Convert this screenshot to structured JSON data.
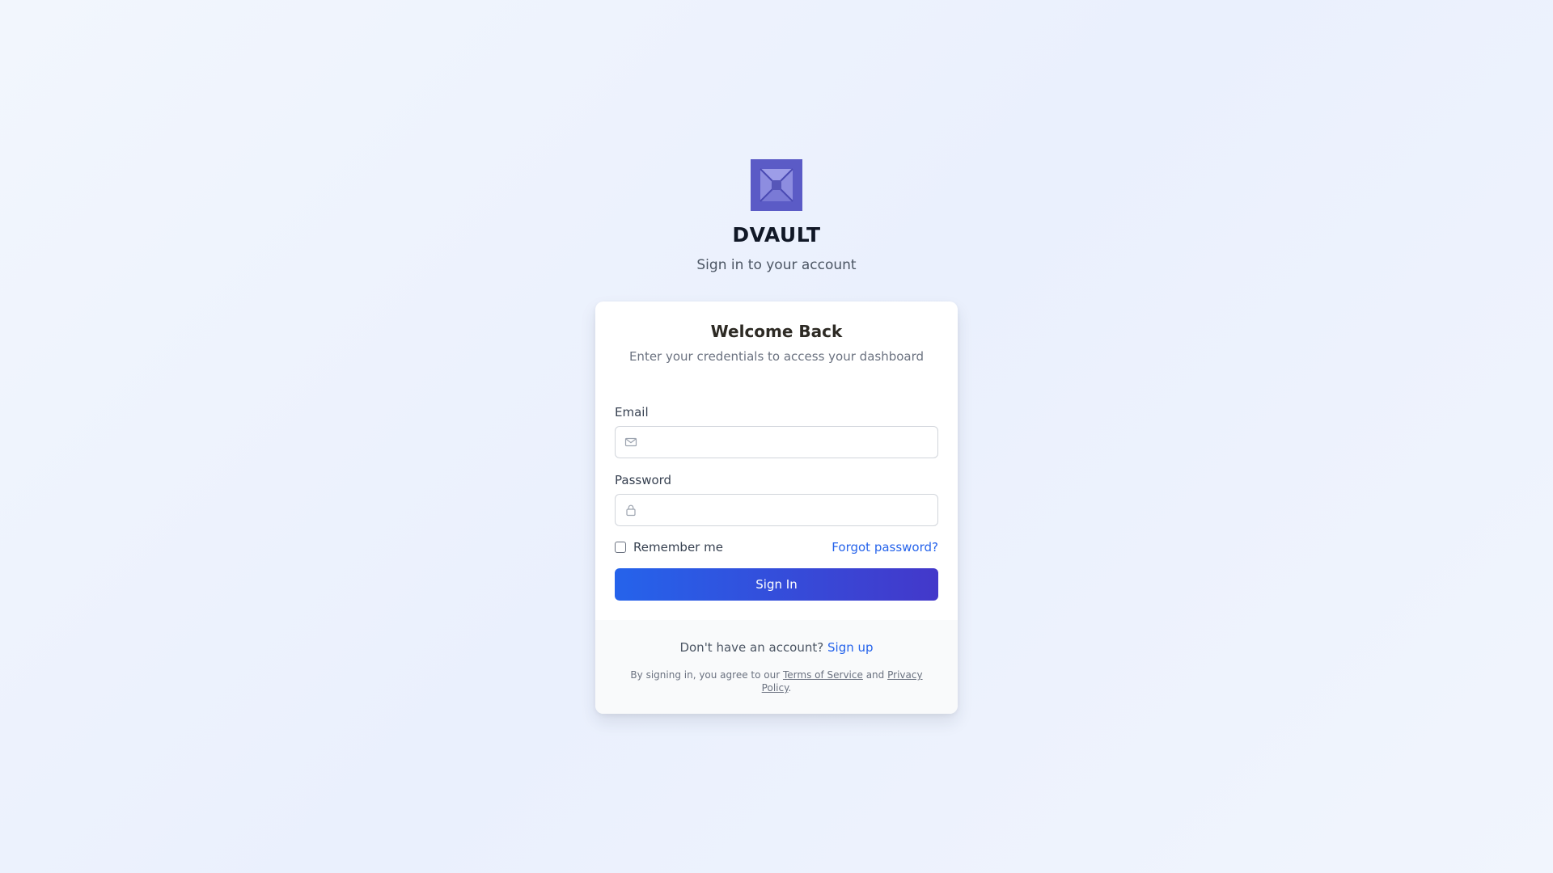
{
  "brand": {
    "name": "DVAULT",
    "tagline": "Sign in to your account",
    "logo_color": "#5b5bc6"
  },
  "card": {
    "title": "Welcome Back",
    "subtitle": "Enter your credentials to access your dashboard"
  },
  "form": {
    "email": {
      "label": "Email",
      "value": "",
      "placeholder": "",
      "icon": "mail-icon"
    },
    "password": {
      "label": "Password",
      "value": "",
      "placeholder": "",
      "icon": "lock-icon"
    },
    "remember": {
      "label": "Remember me",
      "checked": false
    },
    "forgot_label": "Forgot password?",
    "submit_label": "Sign In"
  },
  "footer": {
    "prompt": "Don't have an account?",
    "signup_label": "Sign up",
    "legal_prefix": "By signing in, you agree to our",
    "terms_label": "Terms of Service",
    "legal_and": "and",
    "privacy_label": "Privacy Policy",
    "legal_suffix": "."
  },
  "colors": {
    "accent": "#2563eb",
    "button_gradient_end": "#4338ca",
    "page_background": "#eef3fd"
  }
}
